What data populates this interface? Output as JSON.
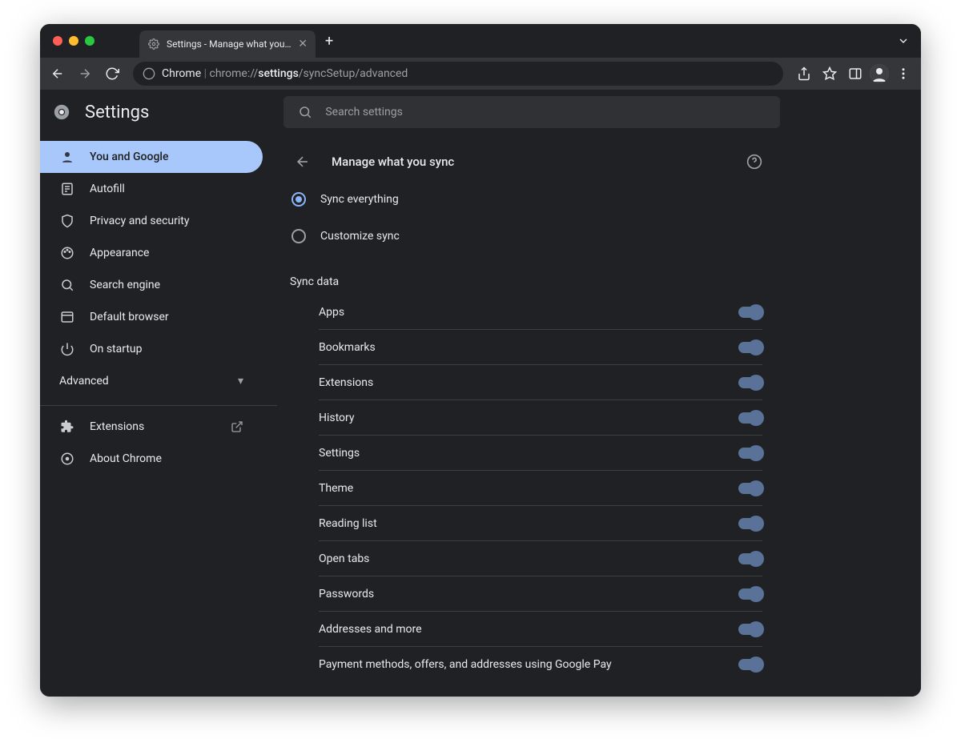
{
  "window": {
    "tab_title": "Settings - Manage what you sy",
    "url_prefix": "Chrome",
    "url_scheme": "chrome://",
    "url_bold": "settings",
    "url_rest": "/syncSetup/advanced"
  },
  "header": {
    "title": "Settings",
    "search_placeholder": "Search settings"
  },
  "sidebar": {
    "items": [
      {
        "label": "You and Google",
        "active": true
      },
      {
        "label": "Autofill"
      },
      {
        "label": "Privacy and security"
      },
      {
        "label": "Appearance"
      },
      {
        "label": "Search engine"
      },
      {
        "label": "Default browser"
      },
      {
        "label": "On startup"
      }
    ],
    "advanced_label": "Advanced",
    "extensions_label": "Extensions",
    "about_label": "About Chrome"
  },
  "panel": {
    "title": "Manage what you sync",
    "radio_sync_everything": "Sync everything",
    "radio_customize": "Customize sync",
    "section_label": "Sync data",
    "items": [
      "Apps",
      "Bookmarks",
      "Extensions",
      "History",
      "Settings",
      "Theme",
      "Reading list",
      "Open tabs",
      "Passwords",
      "Addresses and more",
      "Payment methods, offers, and addresses using Google Pay"
    ]
  }
}
